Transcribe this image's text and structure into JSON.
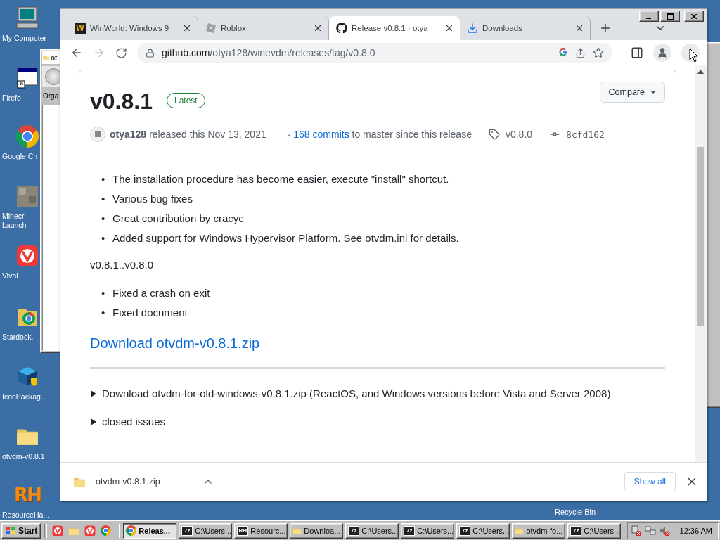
{
  "desktop": {
    "icons": [
      {
        "label": "My Computer",
        "kind": "computer"
      },
      {
        "label": "Firefo",
        "kind": "window"
      },
      {
        "label": "Google Ch",
        "kind": "chrome"
      },
      {
        "label": "Minecr\nLaunch",
        "kind": "block"
      },
      {
        "label": "Vival",
        "kind": "vivaldi"
      },
      {
        "label": "Stardock.",
        "kind": "folder-chrome"
      },
      {
        "label": "IconPackag...",
        "kind": "cube"
      },
      {
        "label": "otvdm-v0.8.1",
        "kind": "folder"
      },
      {
        "label": "ResourceHa...",
        "kind": "logo",
        "logo": "RH"
      }
    ],
    "recycle_bin": {
      "label": "Recycle Bin"
    }
  },
  "explorer_window": {
    "title": "ot",
    "toolbar_label": "Orga"
  },
  "browser": {
    "tabs": [
      {
        "title": "WinWorld: Windows 9",
        "kind": "logo",
        "logo": "W",
        "selected": false
      },
      {
        "title": "Roblox",
        "kind": "tile",
        "selected": false
      },
      {
        "title": "Release v0.8.1 · otya",
        "kind": "github",
        "selected": true
      },
      {
        "title": "Downloads",
        "kind": "download",
        "selected": false
      }
    ],
    "address": {
      "domain": "github.com",
      "path": "/otya128/winevdm/releases/tag/v0.8.0"
    },
    "release": {
      "title": "v0.8.1",
      "badge": "Latest",
      "compare": "Compare",
      "author": "otya128",
      "released": "released this Nov 13, 2021",
      "separator": "·",
      "commits_link": "168 commits",
      "commits_text": "to master since this release",
      "tag": "v0.8.0",
      "commit": "8cfd162",
      "notes": [
        {
          "kind": "list",
          "bullet": "•",
          "items": [
            "The installation procedure has become easier, execute \"install\" shortcut.",
            "Various bug fixes",
            "Great contribution by cracyc",
            "Added support for Windows Hypervisor Platform. See otvdm.ini for details."
          ]
        },
        {
          "kind": "paragraph",
          "text": "v0.8.1..v0.8.0"
        },
        {
          "kind": "list",
          "bullet": "•",
          "items": [
            "Fixed a crash on exit",
            "Fixed document"
          ]
        }
      ],
      "download_link": "Download otvdm-v0.8.1.zip",
      "details": [
        {
          "label": "Download otvdm-for-old-windows-v0.8.1.zip (ReactOS, and Windows versions before Vista and Server 2008)",
          "expanded": false
        },
        {
          "label": "closed issues",
          "expanded": false
        }
      ]
    },
    "download_shelf": {
      "file": "otvdm-v0.8.1.zip",
      "show_all": "Show all"
    }
  },
  "taskbar": {
    "start": "Start",
    "quick_launch": [
      {
        "kind": "vivaldi"
      },
      {
        "kind": "folder"
      },
      {
        "kind": "vivaldi"
      },
      {
        "kind": "chrome"
      }
    ],
    "tasks": [
      {
        "label": "Releas...",
        "kind": "chrome",
        "selected": true
      },
      {
        "label": "C:\\Users...",
        "kind": "logo",
        "logo": "7z",
        "selected": false
      },
      {
        "label": "Resourc...",
        "kind": "logo",
        "logo": "RH",
        "selected": false
      },
      {
        "label": "Downloa...",
        "kind": "folder",
        "selected": false
      },
      {
        "label": "C:\\Users...",
        "kind": "logo",
        "logo": "7z",
        "selected": false
      },
      {
        "label": "C:\\Users...",
        "kind": "logo",
        "logo": "7z",
        "selected": false
      },
      {
        "label": "C:\\Users...",
        "kind": "logo",
        "logo": "7z",
        "selected": false
      },
      {
        "label": "otvdm-fo...",
        "kind": "folder",
        "selected": false
      },
      {
        "label": "C:\\Users...",
        "kind": "logo",
        "logo": "7z",
        "selected": false
      }
    ],
    "clock": "12:36 AM"
  }
}
